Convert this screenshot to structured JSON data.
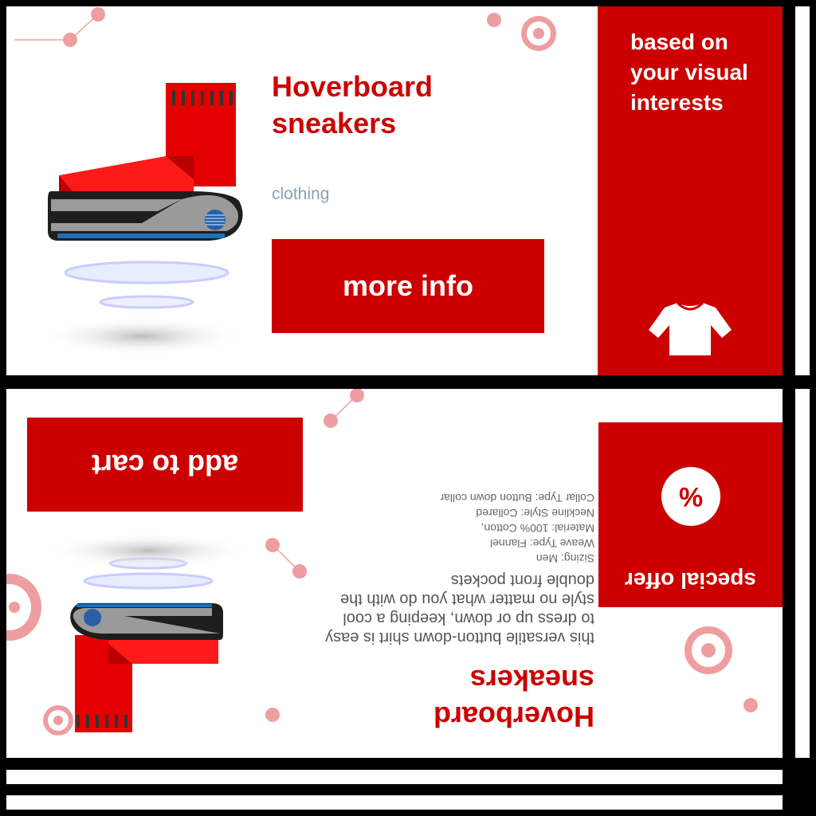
{
  "top_card": {
    "title": "Hoverboard sneakers",
    "category": "clothing",
    "more_info_label": "more info",
    "sidebar_text": "based on your visual interests",
    "sidebar_icon": "shirt-icon"
  },
  "bottom_card": {
    "title": "Hoverboard sneakers",
    "add_to_cart_label": "add to cart",
    "special_offer_label": "special offer",
    "special_offer_icon": "percent-icon",
    "special_offer_symbol": "%",
    "description": "this versatile button-down shirt is easy to dress up or down, keeping a cool style no matter what you do with the double front pockets",
    "specs": [
      "Sizing: Men",
      "Weave Type: Flannel",
      "Material: 100% Cotton,",
      "Neckline Style: Collared",
      "Collar Type: Button down collar"
    ]
  },
  "colors": {
    "accent": "#cc0000",
    "decor": "#ee9ea0",
    "category": "#8aa0b6"
  }
}
